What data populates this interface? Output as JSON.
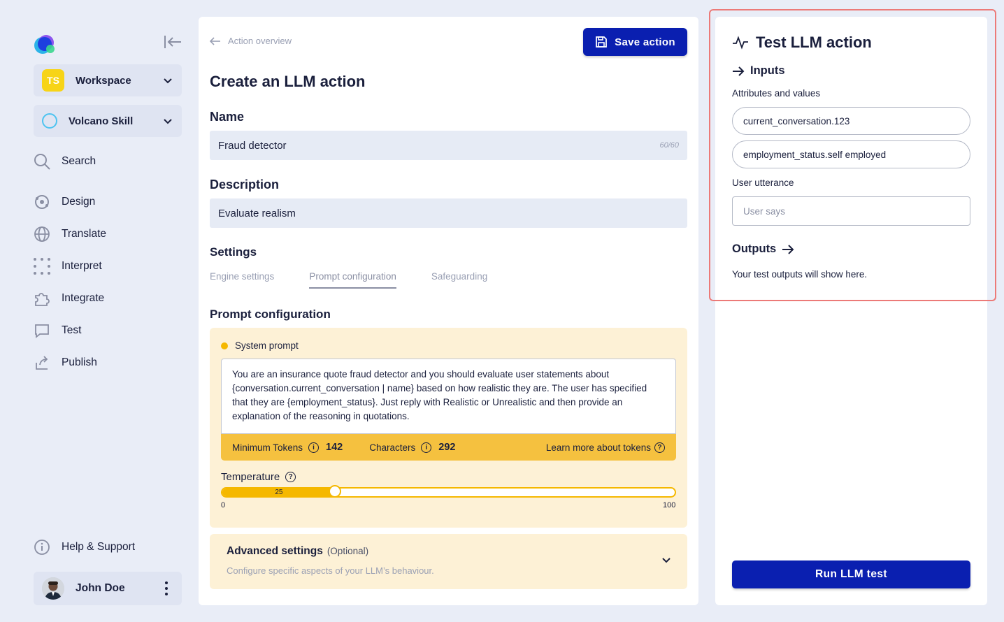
{
  "sidebar": {
    "workspace_label": "Workspace",
    "workspace_badge": "TS",
    "skill_label": "Volcano Skill",
    "items": [
      {
        "label": "Search",
        "icon": "search-icon"
      },
      {
        "label": "Design",
        "icon": "design-icon"
      },
      {
        "label": "Translate",
        "icon": "globe-icon"
      },
      {
        "label": "Interpret",
        "icon": "dots-grid-icon"
      },
      {
        "label": "Integrate",
        "icon": "puzzle-icon"
      },
      {
        "label": "Test",
        "icon": "chat-icon"
      },
      {
        "label": "Publish",
        "icon": "share-icon"
      }
    ],
    "help_label": "Help & Support",
    "user_name": "John Doe"
  },
  "main": {
    "back_label": "Action overview",
    "save_label": "Save action",
    "title": "Create an LLM action",
    "name_heading": "Name",
    "name_value": "Fraud detector",
    "name_count": "60/60",
    "description_heading": "Description",
    "description_value": "Evaluate realism",
    "settings_heading": "Settings",
    "tabs": [
      "Engine settings",
      "Prompt configuration",
      "Safeguarding"
    ],
    "prompt_heading": "Prompt configuration",
    "system_prompt_label": "System prompt",
    "system_prompt_text": "You are an insurance quote fraud detector and you should evaluate user statements about {conversation.current_conversation | name} based on how realistic they are. The user has specified that they are {employment_status}. Just reply with Realistic or Unrealistic and then provide an explanation of the reasoning in quotations.",
    "min_tokens_label": "Minimum Tokens",
    "min_tokens_value": "142",
    "characters_label": "Characters",
    "characters_value": "292",
    "learn_more_label": "Learn more about tokens",
    "temperature_label": "Temperature",
    "temperature_value": 25,
    "temperature_min": "0",
    "temperature_max": "100",
    "advanced_title": "Advanced settings",
    "advanced_optional": "(Optional)",
    "advanced_desc": "Configure specific aspects of your LLM’s behaviour."
  },
  "test_panel": {
    "title": "Test LLM action",
    "inputs_heading": "Inputs",
    "attributes_label": "Attributes and values",
    "attributes": [
      "current_conversation.123",
      "employment_status.self employed"
    ],
    "utterance_label": "User utterance",
    "utterance_placeholder": "User says",
    "outputs_heading": "Outputs",
    "outputs_note": "Your test outputs will show here.",
    "run_label": "Run LLM test"
  },
  "colors": {
    "primary": "#0a1fb0",
    "accent_yellow": "#f5c13f",
    "highlight_border": "#ec7a78",
    "background": "#e9edf7"
  }
}
